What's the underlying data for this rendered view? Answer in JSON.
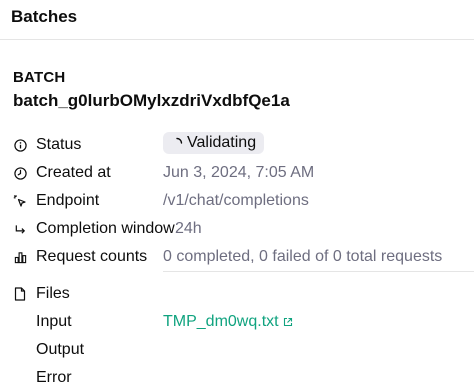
{
  "header": {
    "title": "Batches"
  },
  "batch": {
    "section_label": "BATCH",
    "id": "batch_g0lurbOMylxzdriVxdbfQe1a"
  },
  "details": {
    "status": {
      "label": "Status",
      "value": "Validating",
      "icon": "info-circle-icon"
    },
    "created_at": {
      "label": "Created at",
      "value": "Jun 3, 2024, 7:05 AM",
      "icon": "clock-icon"
    },
    "endpoint": {
      "label": "Endpoint",
      "value": "/v1/chat/completions",
      "icon": "pointer-click-icon"
    },
    "completion_window": {
      "label": "Completion window",
      "value": "24h",
      "icon": "corner-arrow-icon"
    },
    "request_counts": {
      "label": "Request counts",
      "value": "0 completed, 0 failed of 0 total requests",
      "icon": "bar-chart-icon"
    }
  },
  "files": {
    "label": "Files",
    "icon": "file-icon",
    "input_label": "Input",
    "input_value": "TMP_dm0wq.txt",
    "output_label": "Output",
    "error_label": "Error"
  },
  "colors": {
    "link": "#10a37f",
    "muted_text": "#6e6e80",
    "badge_bg": "#ececf1"
  }
}
